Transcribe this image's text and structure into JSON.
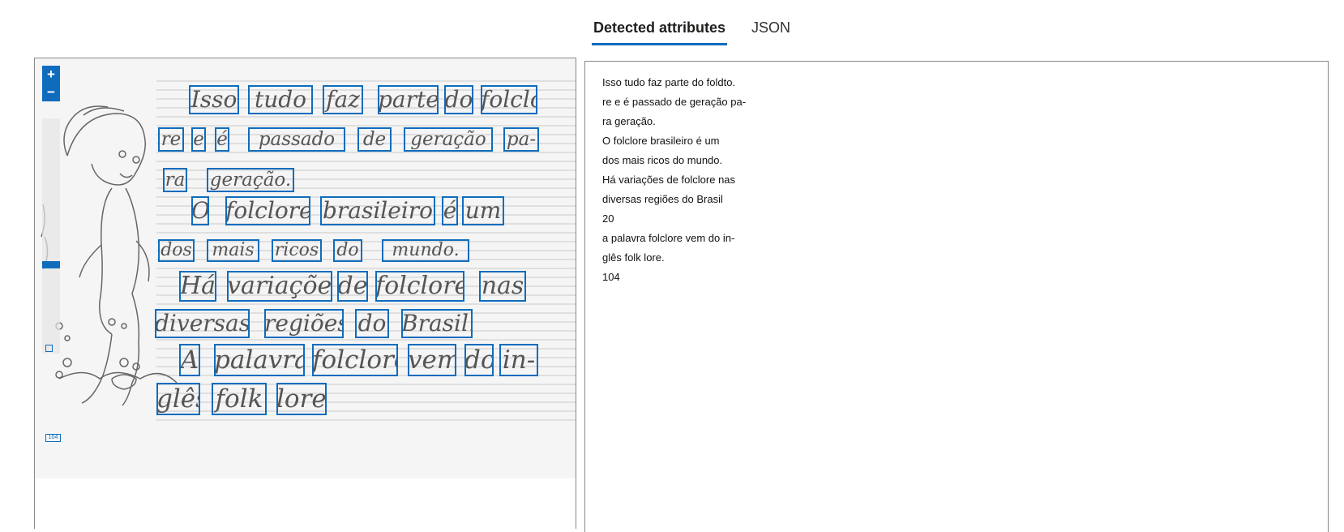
{
  "tabs": [
    {
      "label": "Detected attributes",
      "active": true
    },
    {
      "label": "JSON",
      "active": false
    }
  ],
  "zoom": {
    "in_label": "+",
    "out_label": "−"
  },
  "page_number_label": "104",
  "detected_lines": [
    "Isso tudo faz parte do foldto.",
    "re e é passado de geração pa-",
    "ra geração.",
    "O folclore brasileiro é um",
    "dos mais ricos do mundo.",
    "Há variações de folclore nas",
    "diversas regiões do Brasil",
    "20",
    "a palavra folclore vem do in-",
    "glês folk lore.",
    "104"
  ],
  "handwritten_words": [
    [
      "Isso",
      "tudo",
      "faz",
      "parte",
      "do",
      "folclo-"
    ],
    [
      "re",
      "e",
      "é",
      "passado",
      "de",
      "geração",
      "pa-"
    ],
    [
      "ra",
      "geração."
    ],
    [
      "O",
      "folclore",
      "brasileiro",
      "é",
      "um"
    ],
    [
      "dos",
      "mais",
      "ricos",
      "do",
      "mundo."
    ],
    [
      "Há",
      "variações",
      "de",
      "folclore",
      "nas"
    ],
    [
      "diversas",
      "regiões",
      "do",
      "Brasil."
    ],
    [
      "A",
      "palavra",
      "folclore",
      "vem",
      "do",
      "in-"
    ],
    [
      "glês",
      "folk",
      "lore."
    ]
  ],
  "colors": {
    "accent": "#0f6cbd",
    "text": "#201f1e",
    "border": "#8a8886"
  }
}
